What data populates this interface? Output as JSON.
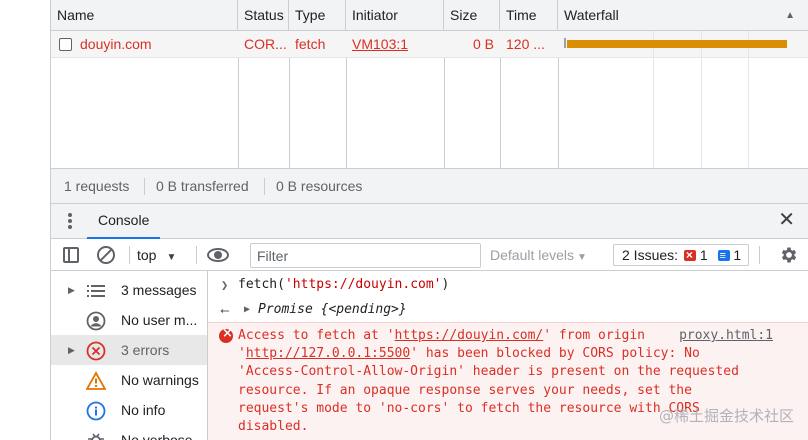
{
  "network": {
    "columns": [
      "Name",
      "Status",
      "Type",
      "Initiator",
      "Size",
      "Time",
      "Waterfall"
    ],
    "rows": [
      {
        "name": "douyin.com",
        "status": "COR...",
        "type": "fetch",
        "initiator": "VM103:1",
        "size": "0 B",
        "time": "120 ..."
      }
    ]
  },
  "summary": {
    "requests": "1 requests",
    "transferred": "0 B transferred",
    "resources": "0 B resources"
  },
  "drawer": {
    "tab": "Console"
  },
  "toolbar": {
    "context": "top",
    "filter_placeholder": "Filter",
    "levels": "Default levels",
    "issues_label": "2 Issues:",
    "issues_errors": "1",
    "issues_info": "1"
  },
  "sidebar": {
    "items": [
      {
        "label": "3 messages",
        "icon": "list-icon"
      },
      {
        "label": "No user m...",
        "icon": "user-icon"
      },
      {
        "label": "3 errors",
        "icon": "error-icon"
      },
      {
        "label": "No warnings",
        "icon": "warning-icon"
      },
      {
        "label": "No info",
        "icon": "info-icon"
      },
      {
        "label": "No verbose",
        "icon": "bug-icon"
      }
    ]
  },
  "console": {
    "input_prefix": "fetch(",
    "input_string": "'https://douyin.com'",
    "input_suffix": ")",
    "result": "Promise {<pending>}",
    "error_source": "proxy.html:1",
    "error_line1_pre": "Access to fetch at '",
    "error_url1": "https://douyin.com/",
    "error_line1_post": "' from origin",
    "error_line2_pre": "'",
    "error_url2": "http://127.0.0.1:5500",
    "error_line2_post": "' has been blocked by CORS policy: No",
    "error_line3": "'Access-Control-Allow-Origin' header is present on the requested",
    "error_line4": "resource. If an opaque response serves your needs, set the",
    "error_line5": "request's mode to 'no-cors' to fetch the resource with CORS",
    "error_line6": "disabled."
  },
  "watermark": "@稀土掘金技术社区"
}
